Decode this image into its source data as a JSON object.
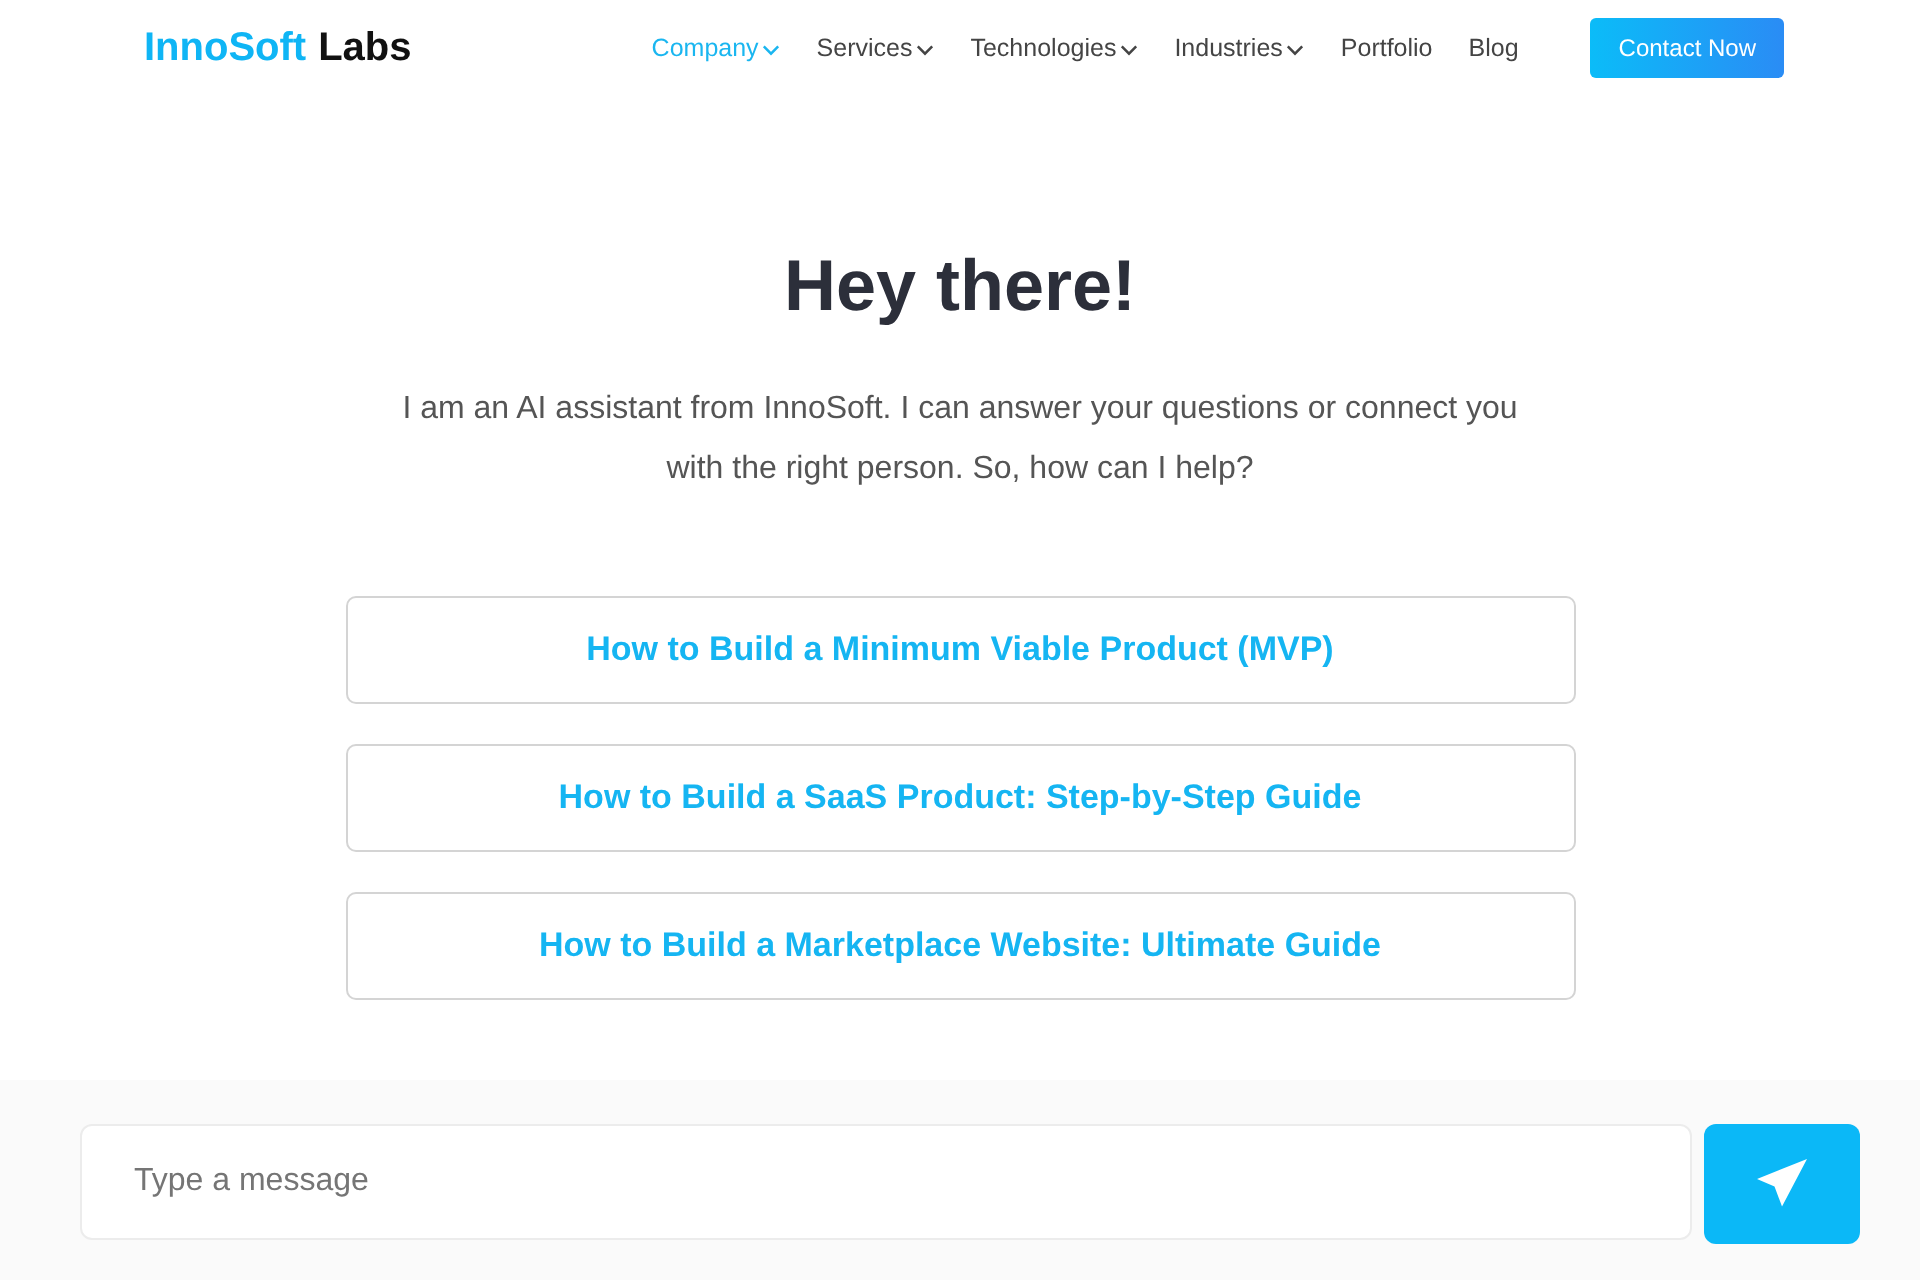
{
  "logo": {
    "brand": "InnoSoft",
    "suffix": "Labs"
  },
  "nav": [
    {
      "label": "Company",
      "selected": true,
      "kind": "dropdown"
    },
    {
      "label": "Services",
      "selected": false,
      "kind": "dropdown"
    },
    {
      "label": "Technologies",
      "selected": false,
      "kind": "dropdown"
    },
    {
      "label": "Industries",
      "selected": false,
      "kind": "dropdown"
    },
    {
      "label": "Portfolio",
      "selected": false,
      "kind": "link"
    },
    {
      "label": "Blog",
      "selected": false,
      "kind": "link"
    }
  ],
  "cta": "Contact Now",
  "heading": "Hey there!",
  "intro": "I am an AI assistant from InnoSoft. I can answer your questions or connect you with the right person. So, how can I help?",
  "suggestions": [
    "How to Build a Minimum Viable Product (MVP)",
    "How to Build a SaaS Product: Step-by-Step Guide",
    "How to Build a Marketplace Website: Ultimate Guide"
  ],
  "composer": {
    "placeholder": "Type a message"
  }
}
